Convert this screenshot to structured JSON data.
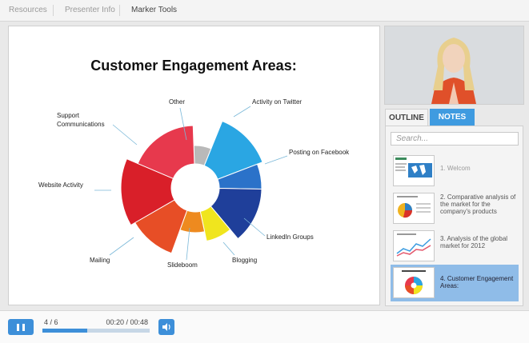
{
  "top_tabs": [
    "Resources",
    "Presenter Info",
    "Marker Tools"
  ],
  "slide": {
    "title": "Customer Engagement Areas:",
    "segments": [
      {
        "label": "Other",
        "color": "#b9b9b9"
      },
      {
        "label": "Activity on Twitter",
        "color": "#2aa6e3"
      },
      {
        "label": "Posting on Facebook",
        "color": "#2b72c9"
      },
      {
        "label": "LinkedIn Groups",
        "color": "#1f3f9a"
      },
      {
        "label": "Blogging",
        "color": "#f0e51e"
      },
      {
        "label": "Slideboom",
        "color": "#ee8a1f"
      },
      {
        "label": "Mailing",
        "color": "#e74e26"
      },
      {
        "label": "Website Activity",
        "color": "#d91f29"
      },
      {
        "label": "Support Communications",
        "color": "#e7394d"
      }
    ]
  },
  "sidebar": {
    "tabs": [
      "OUTLINE",
      "NOTES"
    ],
    "search_placeholder": "Search...",
    "items": [
      {
        "label": "1. Welcom"
      },
      {
        "label": "2. Comparative analysis of the market for the company's products"
      },
      {
        "label": "3. Analysis of the global market for 2012"
      },
      {
        "label": "4. Customer Engagement Areas:"
      }
    ]
  },
  "player": {
    "slide_counter": "4 / 6",
    "time": "00:20 / 00:48",
    "progress": 0.42
  },
  "colors": {
    "accent": "#3d8fd9",
    "selected": "#8fbce8"
  },
  "icons": [
    "pause-icon",
    "speaker-icon"
  ]
}
